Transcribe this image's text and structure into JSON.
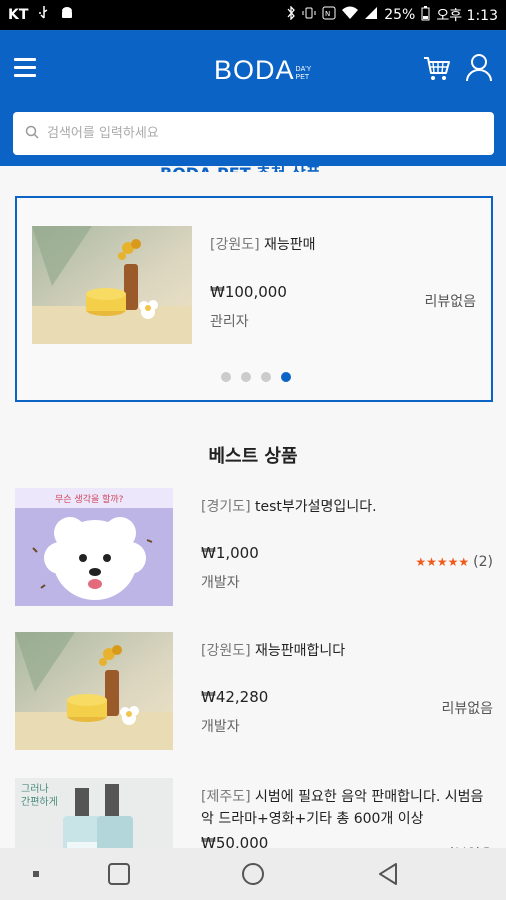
{
  "status_bar": {
    "carrier": "KT",
    "battery": "25%",
    "time": "오후 1:13"
  },
  "header": {
    "logo": "BODA",
    "logo_sub_line1": "DA'Y",
    "logo_sub_line2": "PET",
    "search_placeholder": "검색어를 입력하세요"
  },
  "sections": {
    "peek_title": "BODA PET 추천 상품",
    "best_title": "베스트 상품"
  },
  "featured": {
    "region": "[강원도]",
    "name": "재능판매",
    "price": "₩100,000",
    "seller": "관리자",
    "review": "리뷰없음",
    "dots_total": 4,
    "dots_active_index": 3
  },
  "best_items": [
    {
      "region": "[경기도]",
      "name": "test부가설명입니다.",
      "price": "₩1,000",
      "seller": "개발자",
      "rating_stars": 5,
      "review_count": "(2)",
      "review": ""
    },
    {
      "region": "[강원도]",
      "name": "재능판매합니다",
      "price": "₩42,280",
      "seller": "개발자",
      "review": "리뷰없음"
    },
    {
      "region": "[제주도]",
      "name": "시범에 필요한 음악 판매합니다. 시범음악 드라마+영화+기타 총 600개 이상",
      "price": "₩50,000",
      "seller": "",
      "review": "리뷰없음"
    }
  ],
  "best_image_text": {
    "item0_banner": "무슨 생각을 할까?",
    "item2_banner_line1": "그러나",
    "item2_banner_line2": "간편하게"
  },
  "colors": {
    "primary": "#0b63c5",
    "star": "#ef5b1c"
  },
  "icons": [
    "menu-icon",
    "cart-icon",
    "user-icon",
    "search-icon",
    "nav-recent-icon",
    "nav-home-icon",
    "nav-back-icon"
  ]
}
